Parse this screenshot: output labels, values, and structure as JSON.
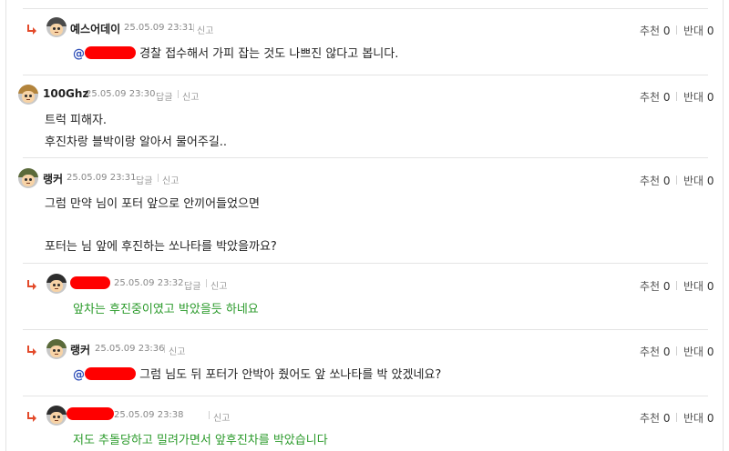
{
  "labels": {
    "up": "추천",
    "down": "반대",
    "reply": "답글",
    "report": "신고"
  },
  "comments": [
    {
      "nick": "예스어데이",
      "date": "25.05.09 23:31",
      "up": "0",
      "down": "0",
      "mention": "@",
      "lines": [
        "경찰 접수해서 가피 잡는 것도 나쁘진 않다고 봅니다."
      ]
    },
    {
      "nick": "100Ghz",
      "date": "25.05.09 23:30",
      "up": "0",
      "down": "0",
      "lines": [
        "트럭 피해자.",
        "후진차랑 블박이랑 알아서 물어주길.."
      ]
    },
    {
      "nick": "랭커",
      "date": "25.05.09 23:31",
      "up": "0",
      "down": "0",
      "lines": [
        "그럼 만약 님이 포터 앞으로 안끼어들었으면",
        "포터는 님 앞에 후진하는 쏘나타를 박았을까요?"
      ]
    },
    {
      "nick": "",
      "date": "25.05.09 23:32",
      "up": "0",
      "down": "0",
      "lines": [
        "앞차는 후진중이였고 박았을듯 하네요"
      ]
    },
    {
      "nick": "랭커",
      "date": "25.05.09 23:36",
      "up": "0",
      "down": "0",
      "mention": "@",
      "lines": [
        "그럼 님도 뒤 포터가 안박아 줬어도 앞 쏘나타를 박 았겠네요?"
      ]
    },
    {
      "nick": "",
      "date": "25.05.09 23:38",
      "up": "0",
      "down": "0",
      "lines": [
        "저도 추돌당하고 밀려가면서 앞후진차를 박았습니다"
      ]
    }
  ],
  "colors": {
    "reply_arrow": "#e34a2a",
    "mention": "#2f4fb8",
    "green_text": "#2a9a2a",
    "redaction": "#ff0000"
  }
}
